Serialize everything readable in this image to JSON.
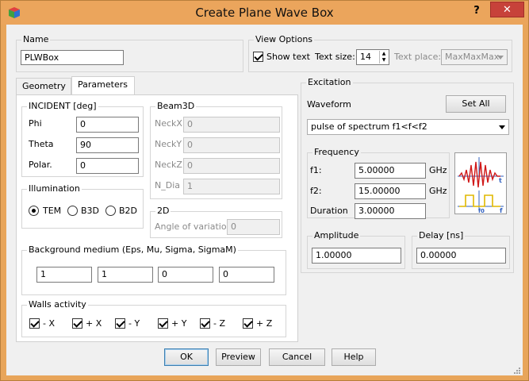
{
  "window": {
    "title": "Create Plane Wave Box",
    "help_glyph": "?",
    "close_glyph": "✕"
  },
  "name_group": {
    "label": "Name",
    "value": "PLWBox"
  },
  "view_options": {
    "label": "View Options",
    "show_text_label": "Show text",
    "show_text_checked": true,
    "text_size_label": "Text size:",
    "text_size_value": "14",
    "text_place_label": "Text place:",
    "text_place_value": "MaxMaxMax"
  },
  "tabs": [
    {
      "label": "Geometry",
      "selected": false
    },
    {
      "label": "Parameters",
      "selected": true
    }
  ],
  "incident": {
    "label": "INCIDENT [deg]",
    "fields": [
      {
        "label": "Phi",
        "value": "0"
      },
      {
        "label": "Theta",
        "value": "90"
      },
      {
        "label": "Polar.",
        "value": "0"
      }
    ]
  },
  "beam3d": {
    "label": "Beam3D",
    "fields": [
      {
        "label": "NeckX",
        "value": "0"
      },
      {
        "label": "NeckY",
        "value": "0"
      },
      {
        "label": "NeckZ",
        "value": "0"
      },
      {
        "label": "N_Dia",
        "value": "1"
      }
    ]
  },
  "illumination": {
    "label": "Illumination",
    "options": [
      {
        "label": "TEM",
        "selected": true
      },
      {
        "label": "B3D",
        "selected": false
      },
      {
        "label": "B2D",
        "selected": false
      }
    ]
  },
  "twod": {
    "label": "2D",
    "angle_label": "Angle of variation",
    "angle_value": "0"
  },
  "background": {
    "label": "Background medium (Eps, Mu, Sigma, SigmaM)",
    "values": [
      "1",
      "1",
      "0",
      "0"
    ]
  },
  "walls": {
    "label": "Walls activity",
    "items": [
      {
        "label": "- X",
        "checked": true
      },
      {
        "label": "+ X",
        "checked": true
      },
      {
        "label": "- Y",
        "checked": true
      },
      {
        "label": "+ Y",
        "checked": true
      },
      {
        "label": "- Z",
        "checked": true
      },
      {
        "label": "+ Z",
        "checked": true
      }
    ]
  },
  "excitation": {
    "label": "Excitation",
    "waveform_label": "Waveform",
    "set_all_label": "Set All",
    "waveform_value": "pulse of spectrum f1<f<f2",
    "frequency": {
      "label": "Frequency",
      "f1_label": "f1:",
      "f1_value": "5.00000",
      "f1_unit": "GHz",
      "f2_label": "f2:",
      "f2_value": "15.00000",
      "f2_unit": "GHz",
      "duration_label": "Duration",
      "duration_value": "3.00000"
    },
    "preview_glyphs": {
      "t1": "t",
      "f0": "f0",
      "f": "f"
    },
    "amplitude": {
      "label": "Amplitude",
      "value": "1.00000"
    },
    "delay": {
      "label": "Delay [ns]",
      "value": "0.00000"
    }
  },
  "buttons": {
    "ok": "OK",
    "preview": "Preview",
    "cancel": "Cancel",
    "help": "Help"
  },
  "colors": {
    "titlebar": "#eba55c",
    "close": "#c7423a",
    "signal_red": "#d01818",
    "spectrum_yellow": "#e0b800"
  }
}
